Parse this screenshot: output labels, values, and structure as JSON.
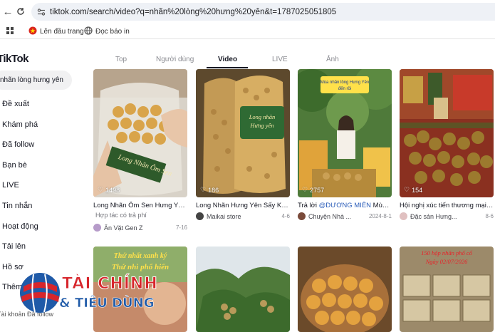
{
  "browser": {
    "url": "tiktok.com/search/video?q=nhãn%20lòng%20hưng%20yên&t=1787025051805",
    "bookmarks": [
      {
        "label": "Lên đầu trang",
        "icon": "flag-icon"
      },
      {
        "label": "Đọc báo in",
        "icon": "globe-icon"
      }
    ]
  },
  "sidebar": {
    "logo": "TikTok",
    "search_query": "nhãn lòng hưng yên",
    "items": [
      {
        "label": "Đề xuất"
      },
      {
        "label": "Khám phá"
      },
      {
        "label": "Đã follow"
      },
      {
        "label": "Bạn bè"
      },
      {
        "label": "LIVE"
      },
      {
        "label": "Tin nhắn"
      },
      {
        "label": "Hoạt động"
      },
      {
        "label": "Tải lên"
      },
      {
        "label": "Hồ sơ"
      },
      {
        "label": "Thêm"
      }
    ],
    "footer": "Tài khoản Đã follow"
  },
  "tabs": [
    {
      "label": "Top"
    },
    {
      "label": "Người dùng"
    },
    {
      "label": "Video"
    },
    {
      "label": "LIVE"
    },
    {
      "label": "Ảnh"
    }
  ],
  "active_tab": "Video",
  "videos": [
    {
      "likes": "1498",
      "title": "Long Nhãn Ôm Sen Hưng Yên, ...",
      "subtitle": "Hợp tác có trả phí",
      "author": "Ăn Vặt Gen Z",
      "date": "7-16",
      "overlay": "Long Nhãn Ôm Sen"
    },
    {
      "likes": "186",
      "title": "Long Nhãn Hưng Yên Sấy Khô ...",
      "author": "Maikai store",
      "date": "4-6",
      "overlay": "Long nhãn Hưng yên"
    },
    {
      "likes": "2757",
      "title": "Trả lời",
      "mention": "@DƯƠNG MIÊN",
      "title_rest": " Mùa Nh...",
      "author": "Chuyện Nhà ...",
      "date": "2024-8-1",
      "overlay": "Mùa nhãn lồng Hưng Yên"
    },
    {
      "likes": "154",
      "title": "Hội nghị xúc tiến thương mại v...",
      "author": "Đặc sản Hưng...",
      "date": "8-6"
    }
  ],
  "row2": [
    {
      "overlay1": "Thứ nhất xanh ký",
      "overlay2": "Thứ nhì phố hiến"
    },
    {},
    {},
    {
      "overlay1": "150 hộp nhãn phố cổ",
      "overlay2": "Ngày 02/07/2026"
    }
  ],
  "watermark": {
    "line1": "TÀI CHÍNH",
    "line2": "& TIÊU DÙNG"
  },
  "colors": {
    "mention": "#2b5db9",
    "accent": "#fe2c55",
    "text": "#161823"
  }
}
